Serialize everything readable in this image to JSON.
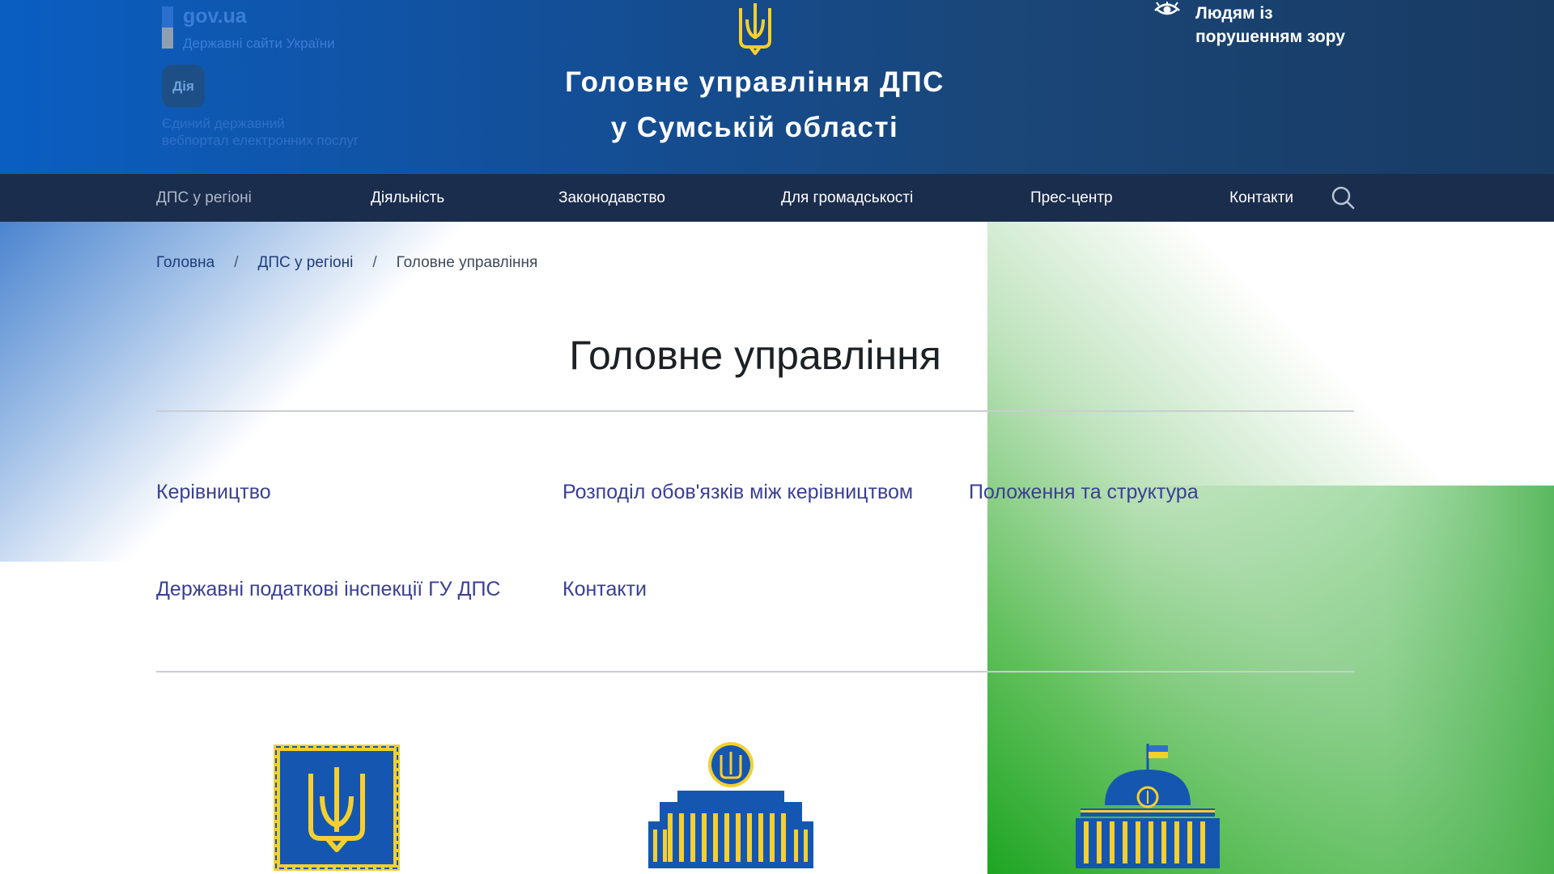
{
  "header": {
    "govua_name": "gov.ua",
    "govua_sub": "Державні сайти України",
    "diia_logo": "Дія",
    "diia_line1": "Єдиний державний",
    "diia_line2": "вебпортал електронних послуг",
    "org_line1": "Головне управління ДПС",
    "org_line2": "у Сумській області",
    "vision_line1": "Людям із",
    "vision_line2": "порушенням зору",
    "icons": [
      "trident-icon",
      "eye-icon"
    ]
  },
  "nav": {
    "items": [
      "ДПС у регіоні",
      "Діяльність",
      "Законодавство",
      "Для громадськості",
      "Прес-центр",
      "Контакти"
    ],
    "search_icon": "search-icon"
  },
  "breadcrumb": {
    "items": [
      "Головна",
      "ДПС у регіоні",
      "Головне управління"
    ],
    "separator": "/"
  },
  "page": {
    "title": "Головне управління",
    "links": [
      "Керівництво",
      "Розподіл обов'язків між керівництвом",
      "Положення та структура",
      "Державні податкові інспекції ГУ ДПС",
      "Контакти"
    ],
    "emblems": [
      "president-standard-icon",
      "government-building-icon",
      "parliament-building-icon"
    ]
  },
  "colors": {
    "header_blue": "#0a5ec2",
    "nav_dark": "#1b2d4d",
    "link_purple": "#3a3f93",
    "emblem_blue": "#1557b0",
    "emblem_gold": "#f5cf2f"
  }
}
